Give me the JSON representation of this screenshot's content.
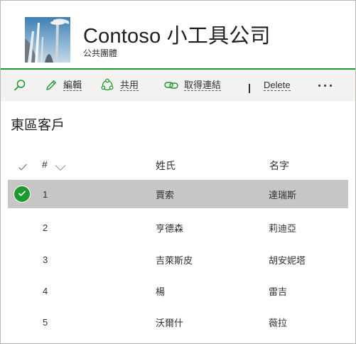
{
  "site": {
    "title": "Contoso 小工具公司",
    "subtitle": "公共團體"
  },
  "colors": {
    "accent": "#1b9a2f",
    "command_bar_bg": "#f3f2f1",
    "selected_row_bg": "#c8c6c4"
  },
  "command_bar": {
    "search_icon": "search-icon",
    "edit_label": "編輯",
    "share_label": "共用",
    "copy_link_label": "取得連結",
    "delete_label": "Delete",
    "more_icon": "more-icon"
  },
  "list": {
    "title": "東區客戶",
    "columns": {
      "number": "#",
      "last_name": "姓氏",
      "first_name": "名字"
    },
    "rows": [
      {
        "number": "1",
        "last_name": "賈索",
        "first_name": "達瑞斯",
        "selected": true
      },
      {
        "number": "2",
        "last_name": "亨德森",
        "first_name": "莉迪亞",
        "selected": false
      },
      {
        "number": "3",
        "last_name": "吉萊斯皮",
        "first_name": "胡安妮塔",
        "selected": false
      },
      {
        "number": "4",
        "last_name": "楊",
        "first_name": "雷吉",
        "selected": false
      },
      {
        "number": "5",
        "last_name": "沃爾什",
        "first_name": "薇拉",
        "selected": false
      }
    ]
  }
}
